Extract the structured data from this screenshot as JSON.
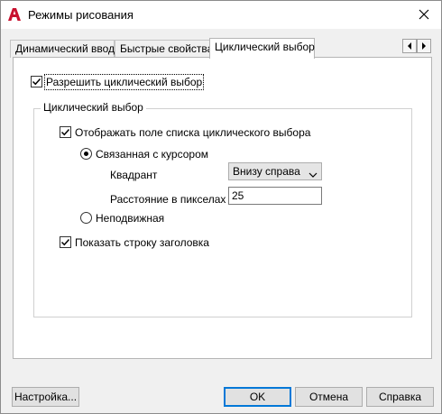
{
  "window": {
    "title": "Режимы рисования",
    "app_icon": "autocad-a-icon"
  },
  "tabs": [
    {
      "label": "Динамический ввод",
      "active": false
    },
    {
      "label": "Быстрые свойства",
      "active": false
    },
    {
      "label": "Циклический выбор",
      "active": true
    }
  ],
  "tab_scroll": {
    "left": "◂",
    "right": "▸"
  },
  "enable_cycling": {
    "label": "Разрешить циклический выбор",
    "checked": true
  },
  "group": {
    "title": "Циклический выбор",
    "show_list": {
      "label": "Отображать поле списка циклического выбора",
      "checked": true
    },
    "cursor_dependent": {
      "label": "Связанная с курсором",
      "selected": true
    },
    "quadrant": {
      "label": "Квадрант",
      "value": "Внизу справа"
    },
    "distance": {
      "label": "Расстояние в пикселах",
      "value": "25"
    },
    "static": {
      "label": "Неподвижная",
      "selected": false
    },
    "show_title_bar": {
      "label": "Показать строку заголовка",
      "checked": true
    }
  },
  "buttons": {
    "settings": "Настройка...",
    "ok": "OK",
    "cancel": "Отмена",
    "help": "Справка"
  },
  "colors": {
    "accent": "#0078d7",
    "brand": "#c8102e"
  }
}
